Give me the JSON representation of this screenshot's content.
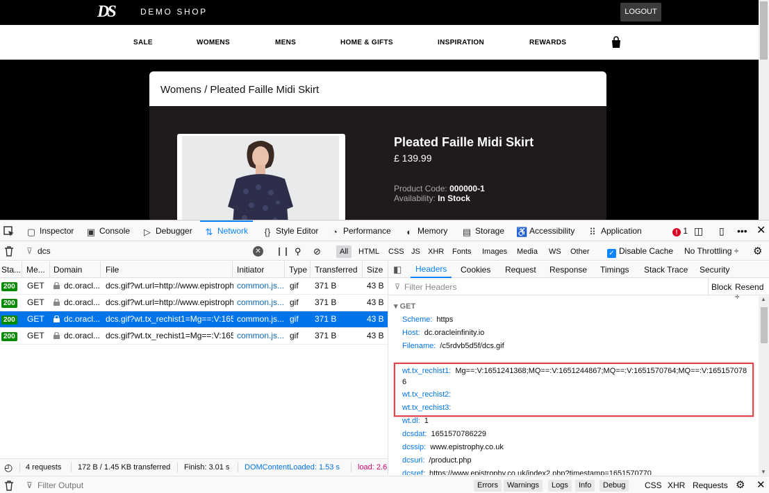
{
  "site": {
    "logo": "DS",
    "shop_name": "DEMO SHOP",
    "logout_label": "LOGOUT",
    "nav": [
      "SALE",
      "WOMENS",
      "MENS",
      "HOME & GIFTS",
      "INSPIRATION",
      "REWARDS"
    ],
    "breadcrumb": "Womens / Pleated Faille Midi Skirt",
    "product": {
      "name": "Pleated Faille Midi Skirt",
      "price": "£ 139.99",
      "code_label": "Product Code:",
      "code_value": "000000-1",
      "availability_label": "Availability:",
      "availability_value": "In Stock"
    }
  },
  "devtools": {
    "tabs": [
      "Inspector",
      "Console",
      "Debugger",
      "Network",
      "Style Editor",
      "Performance",
      "Memory",
      "Storage",
      "Accessibility",
      "Application"
    ],
    "active_tab": "Network",
    "error_count": "1",
    "filter_value": "dcs",
    "type_filters": [
      "All",
      "HTML",
      "CSS",
      "JS",
      "XHR",
      "Fonts",
      "Images",
      "Media",
      "WS",
      "Other"
    ],
    "disable_cache_label": "Disable Cache",
    "throttling_label": "No Throttling ÷",
    "columns": [
      "Sta...",
      "Me...",
      "Domain",
      "File",
      "Initiator",
      "Type",
      "Transferred",
      "Size"
    ],
    "requests": [
      {
        "status": "200",
        "method": "GET",
        "domain": "dc.oracl...",
        "file": "dcs.gif?wt.url=http://www.epistrophy",
        "initiator": "common.js...",
        "type": "gif",
        "transferred": "371 B",
        "size": "43 B"
      },
      {
        "status": "200",
        "method": "GET",
        "domain": "dc.oracl...",
        "file": "dcs.gif?wt.url=http://www.epistrophy",
        "initiator": "common.js...",
        "type": "gif",
        "transferred": "371 B",
        "size": "43 B"
      },
      {
        "status": "200",
        "method": "GET",
        "domain": "dc.oracl...",
        "file": "dcs.gif?wt.tx_rechist1=Mg==:V:165",
        "initiator": "common.js...",
        "type": "gif",
        "transferred": "371 B",
        "size": "43 B"
      },
      {
        "status": "200",
        "method": "GET",
        "domain": "dc.oracl...",
        "file": "dcs.gif?wt.tx_rechist1=Mg==:V:165",
        "initiator": "common.js...",
        "type": "gif",
        "transferred": "371 B",
        "size": "43 B"
      }
    ],
    "detail_tabs": [
      "Headers",
      "Cookies",
      "Request",
      "Response",
      "Timings",
      "Stack Trace",
      "Security"
    ],
    "filter_headers_placeholder": "Filter Headers",
    "block_label": "Block",
    "resend_label": "Resend ÷",
    "section_title": "GET",
    "params": [
      {
        "key": "Scheme:",
        "value": "https"
      },
      {
        "key": "Host:",
        "value": "dc.oracleinfinity.io"
      },
      {
        "key": "Filename:",
        "value": "/c5rdvb5d5f/dcs.gif"
      },
      {
        "key": "wt.tx_rechist1:",
        "value": "Mg==:V:1651241368;MQ==:V:1651244867;MQ==:V:1651570764;MQ==:V:1651570786"
      },
      {
        "key": "wt.tx_rechist2:",
        "value": ""
      },
      {
        "key": "wt.tx_rechist3:",
        "value": ""
      },
      {
        "key": "wt.dl:",
        "value": "1"
      },
      {
        "key": "dcsdat:",
        "value": "1651570786229"
      },
      {
        "key": "dcssip:",
        "value": "www.epistrophy.co.uk"
      },
      {
        "key": "dcsuri:",
        "value": "/product.php"
      },
      {
        "key": "dcsref:",
        "value": "https://www.epistrophy.co.uk/index2.php?timestamp=1651570770"
      }
    ],
    "status_bar": {
      "requests": "4 requests",
      "transferred": "172 B / 1.45 KB transferred",
      "finish": "Finish: 3.01 s",
      "dom_loaded": "DOMContentLoaded: 1.53 s",
      "load": "load: 2.6"
    },
    "console_bar": {
      "filter_placeholder": "Filter Output",
      "buttons": [
        "Errors",
        "Warnings",
        "Logs",
        "Info",
        "Debug"
      ],
      "extras": [
        "CSS",
        "XHR",
        "Requests"
      ]
    },
    "colors": {
      "accent": "#0a84ff",
      "selected_row": "#0074e8",
      "status_ok": "#058b00",
      "highlight": "#e1454b"
    }
  }
}
